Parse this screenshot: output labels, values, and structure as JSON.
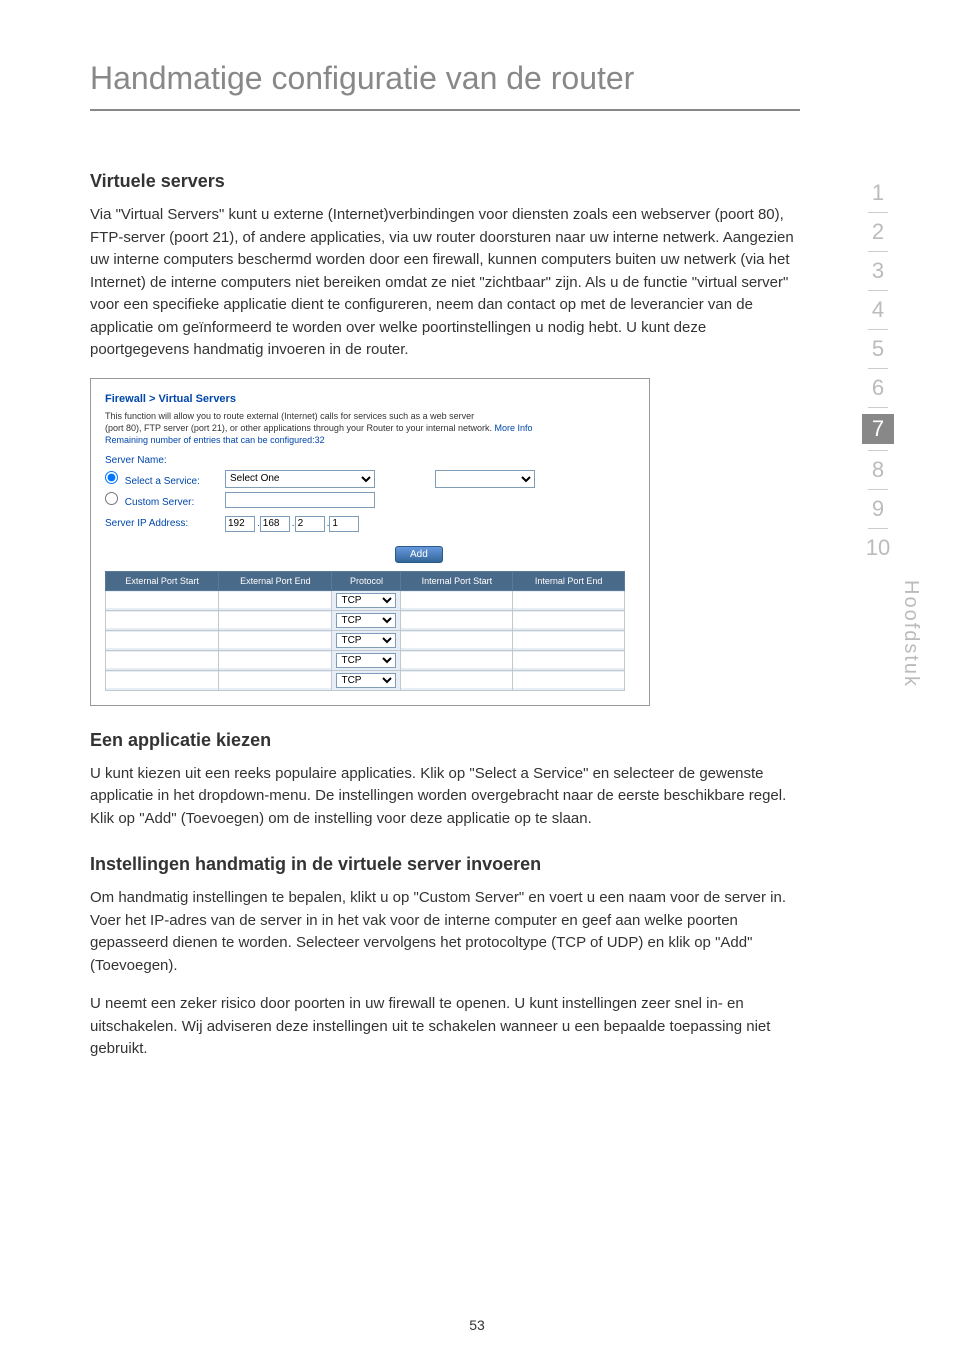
{
  "page": {
    "title": "Handmatige configuratie van de router",
    "number": "53",
    "side_label": "Hoofdstuk"
  },
  "section1": {
    "heading": "Virtuele servers",
    "para": "Via \"Virtual Servers\" kunt u externe (Internet)verbindingen voor diensten zoals een webserver (poort 80), FTP-server (poort 21), of andere applicaties, via uw router doorsturen naar uw interne netwerk. Aangezien uw interne computers beschermd worden door een firewall, kunnen computers buiten uw netwerk (via het Internet) de interne computers niet bereiken omdat ze niet \"zichtbaar\" zijn. Als u de functie \"virtual server\" voor een specifieke applicatie dient te configureren, neem dan contact op met de leverancier van de applicatie om geïnformeerd te worden over welke poortinstellingen u nodig hebt. U kunt deze poortgegevens handmatig invoeren in de router."
  },
  "screenshot": {
    "breadcrumb": "Firewall > Virtual Servers",
    "desc1": "This function will allow you to route external (Internet) calls for services such as a web server",
    "desc2": "(port 80), FTP server (port 21), or other applications through your Router to your internal network.",
    "more_info": "More Info",
    "remaining": "Remaining number of entries that can be configured:32",
    "server_name": "Server Name:",
    "select_service": "Select a Service:",
    "select_option": "Select One",
    "custom_server": "Custom Server:",
    "server_ip": "Server IP Address:",
    "ip": {
      "a": "192",
      "b": "168",
      "c": "2",
      "d": "1"
    },
    "add": "Add",
    "headers": {
      "ext_start": "External Port Start",
      "ext_end": "External Port End",
      "protocol": "Protocol",
      "int_start": "Internal Port Start",
      "int_end": "Internal Port End"
    },
    "protocol_option": "TCP"
  },
  "section2": {
    "heading": "Een applicatie kiezen",
    "para": "U kunt kiezen uit een reeks populaire applicaties. Klik op \"Select a Service\" en selecteer de gewenste applicatie in het dropdown-menu. De instellingen worden overgebracht naar de eerste beschikbare regel. Klik op \"Add\" (Toevoegen) om de instelling voor deze applicatie op te slaan."
  },
  "section3": {
    "heading": "Instellingen handmatig in de virtuele server invoeren",
    "para1": "Om handmatig instellingen te bepalen, klikt u op \"Custom Server\" en voert u een naam voor de server in. Voer het IP-adres van de server in in het vak voor de interne computer en geef aan welke poorten gepasseerd dienen te worden. Selecteer vervolgens het protocoltype (TCP of UDP) en klik op \"Add\" (Toevoegen).",
    "para2": "U neemt een zeker risico door poorten in uw firewall te openen. U kunt instellingen zeer snel in- en uitschakelen. Wij adviseren deze instellingen uit te schakelen wanneer u een bepaalde toepassing niet gebruikt."
  },
  "tabs": [
    "1",
    "2",
    "3",
    "4",
    "5",
    "6",
    "7",
    "8",
    "9",
    "10"
  ],
  "active_tab": "7"
}
